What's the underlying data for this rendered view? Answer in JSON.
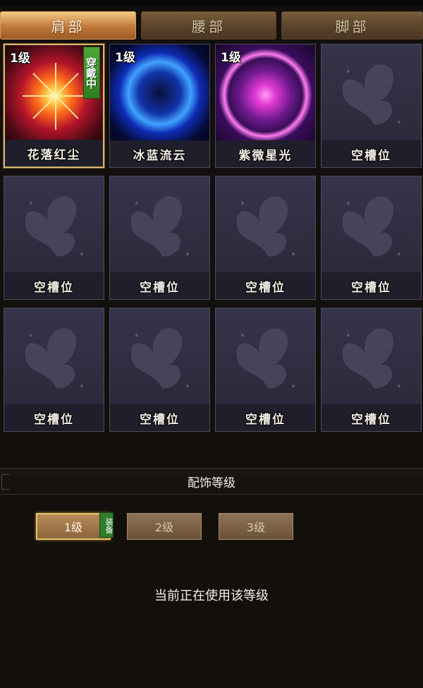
{
  "tabs": [
    {
      "label": "肩部",
      "active": true
    },
    {
      "label": "腰部",
      "active": false
    },
    {
      "label": "脚部",
      "active": false
    }
  ],
  "slots": [
    {
      "name": "花落红尘",
      "level": "1级",
      "badge": "穿戴中",
      "art": "red-orb"
    },
    {
      "name": "冰蓝流云",
      "level": "1级",
      "art": "blue-orb"
    },
    {
      "name": "紫微星光",
      "level": "1级",
      "art": "purple-orb"
    },
    {
      "name": "空槽位"
    },
    {
      "name": "空槽位"
    },
    {
      "name": "空槽位"
    },
    {
      "name": "空槽位"
    },
    {
      "name": "空槽位"
    },
    {
      "name": "空槽位"
    },
    {
      "name": "空槽位"
    },
    {
      "name": "空槽位"
    },
    {
      "name": "空槽位"
    }
  ],
  "section": {
    "title": "配饰等级"
  },
  "levels": [
    {
      "label": "1级",
      "active": true,
      "tag": "装备"
    },
    {
      "label": "2级",
      "active": false
    },
    {
      "label": "3级",
      "active": false
    }
  ],
  "status_text": "当前正在使用该等级",
  "colors": {
    "accent": "#d6b574",
    "wearing_badge": "#3b9a2c",
    "slot_bg": "#2a2838"
  }
}
